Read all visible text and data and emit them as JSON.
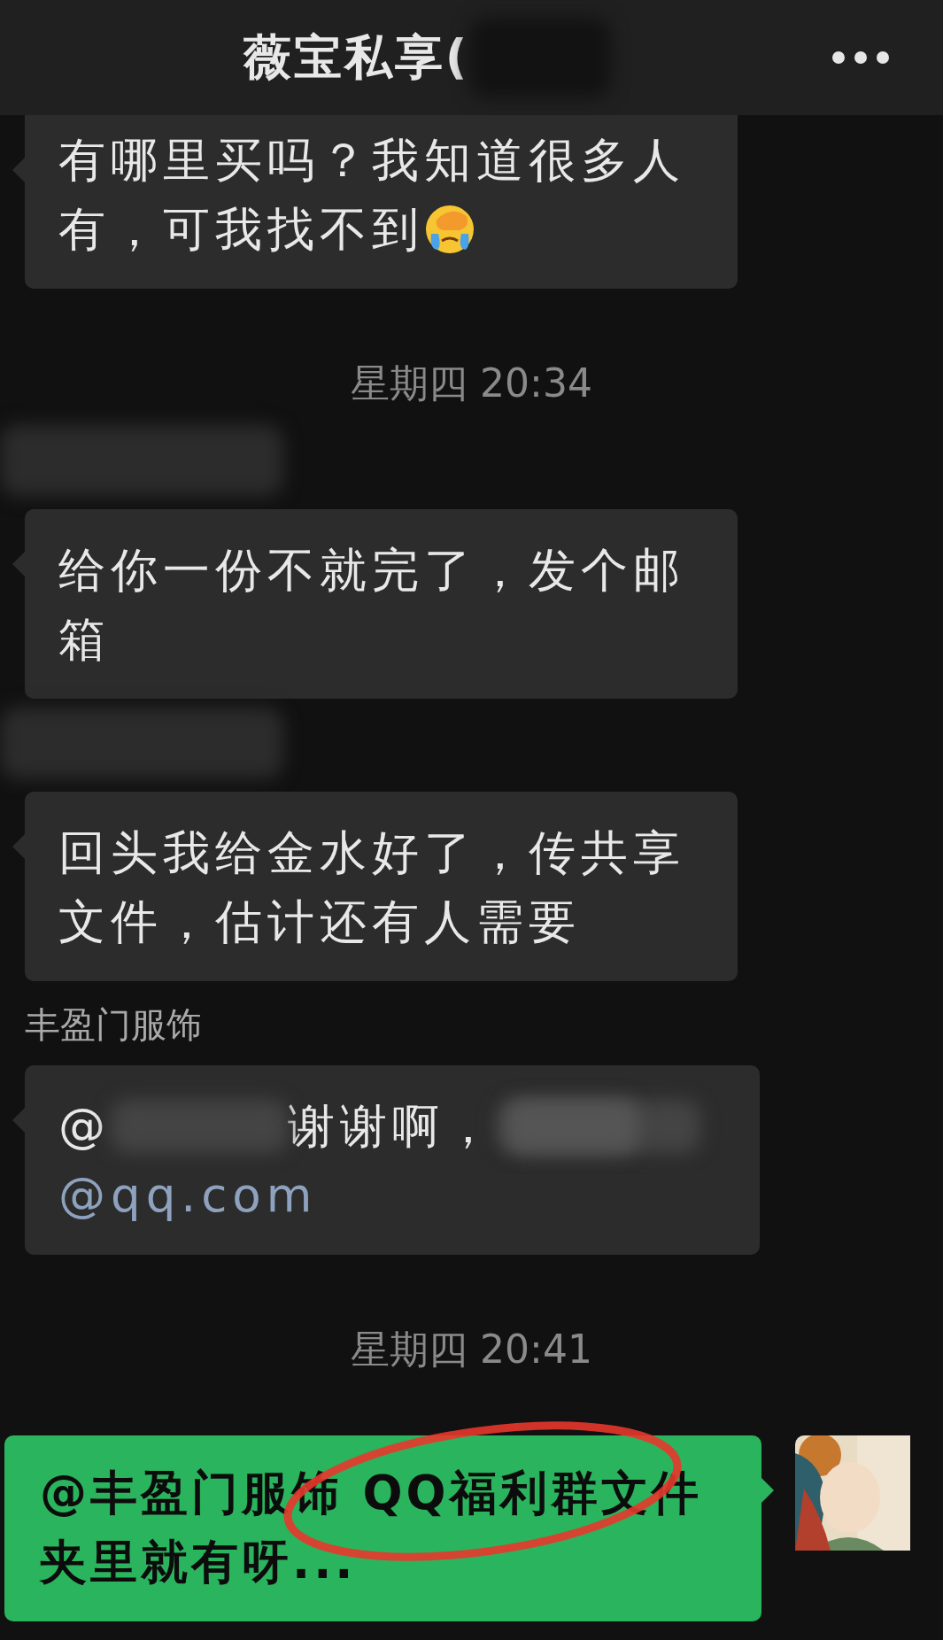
{
  "header": {
    "title": "薇宝私享(",
    "title_blurred": true
  },
  "messages": [
    {
      "kind": "incoming",
      "lines": [
        "有哪里买吗？我知道很多人",
        "有，可我找不到"
      ],
      "emoji": true
    },
    {
      "kind": "time",
      "text": "星期四 20:34"
    },
    {
      "kind": "incoming",
      "sender_blurred": true,
      "lines": [
        "给你一份不就完了，发个邮",
        "箱"
      ]
    },
    {
      "kind": "incoming",
      "sender_blurred": true,
      "lines": [
        "回头我给金水好了，传共享",
        "文件，估计还有人需要"
      ]
    },
    {
      "kind": "incoming",
      "sender": "丰盈门服饰",
      "parts": [
        {
          "kind": "text",
          "text": "@"
        },
        {
          "kind": "blurred"
        },
        {
          "kind": "text",
          "text": "谢谢啊，"
        },
        {
          "kind": "blurred"
        },
        {
          "kind": "blurred"
        },
        {
          "kind": "link",
          "text": "@qq.com"
        }
      ]
    },
    {
      "kind": "time",
      "text": "星期四 20:41"
    },
    {
      "kind": "outgoing",
      "text": "@丰盈门服饰 QQ福利群文件夹里就有呀...",
      "circled": true
    }
  ]
}
